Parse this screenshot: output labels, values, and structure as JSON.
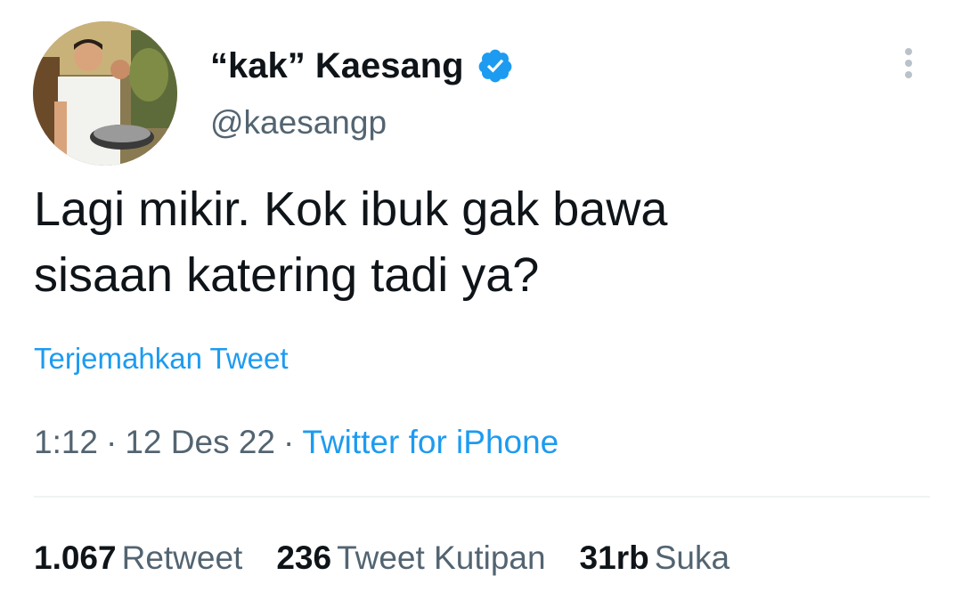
{
  "author": {
    "display_name": "“kak” Kaesang",
    "handle": "@kaesangp",
    "verified_icon": "verified-badge-icon",
    "colors": {
      "verified": "#1d9bf0"
    }
  },
  "tweet": {
    "text_lines": [
      "Lagi mikir. Kok ibuk gak bawa",
      "sisaan katering tadi ya?"
    ],
    "translate_label": "Terjemahkan Tweet",
    "time": "1:12",
    "separator": "·",
    "date": "12 Des 22",
    "source": "Twitter for iPhone"
  },
  "stats": {
    "retweets": {
      "value": "1.067",
      "label": "Retweet"
    },
    "quotes": {
      "value": "236",
      "label": "Tweet Kutipan"
    },
    "likes": {
      "value": "31rb",
      "label": "Suka"
    }
  },
  "colors": {
    "text": "#0f1419",
    "secondary": "#536471",
    "link": "#1d9bf0",
    "divider": "#eff3f4"
  }
}
